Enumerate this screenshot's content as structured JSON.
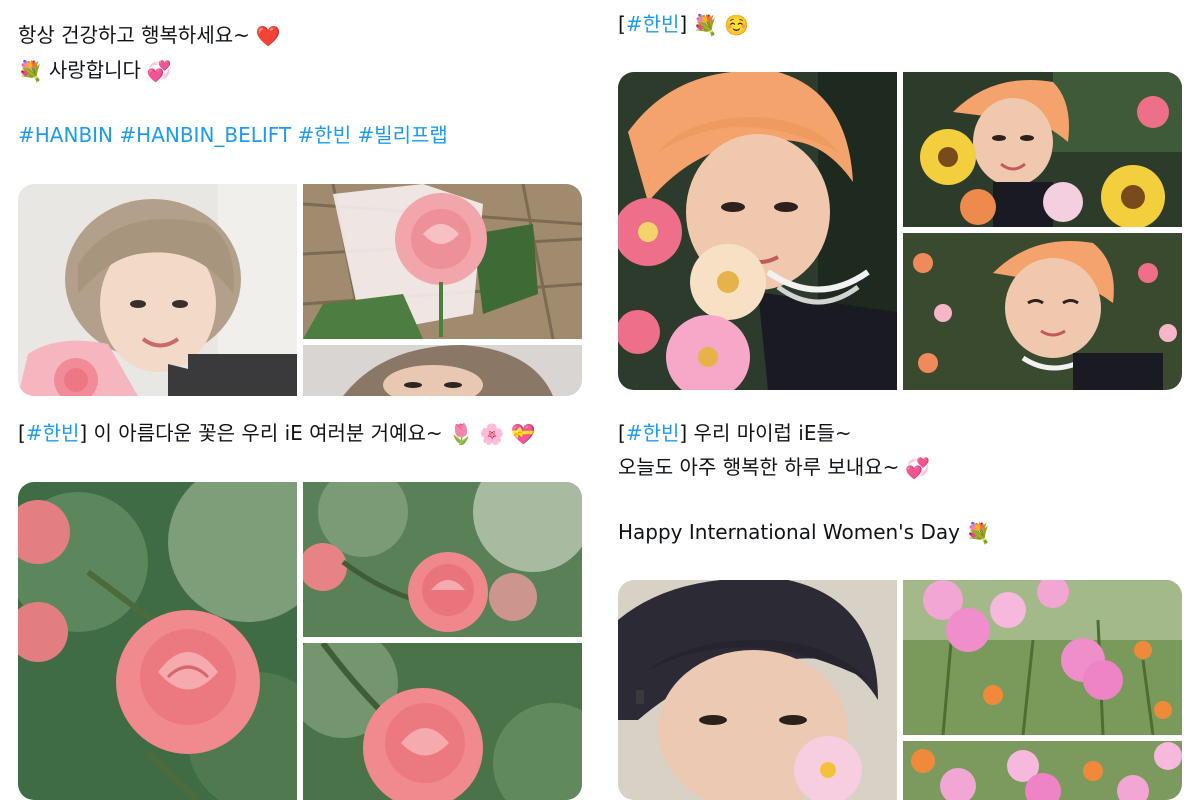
{
  "left_post_1": {
    "line1": "항상 건강하고 행복하세요~",
    "line1_emoji": "❤️",
    "line2_emoji": "💐",
    "line2": "사랑합니다",
    "line2_emoji_end": "💞",
    "hashtags": [
      "#HANBIN",
      "#HANBIN_BELIFT",
      "#한빈",
      "#빌리프랩"
    ],
    "photos": [
      {
        "name": "hanbin-bouquet-photo",
        "desc": "portrait-with-pink-roses"
      },
      {
        "name": "pink-rose-bouquet-photo",
        "desc": "pink-rose"
      },
      {
        "name": "hanbin-closeup-photo",
        "desc": "closeup"
      }
    ]
  },
  "left_post_2": {
    "bracket_open": "[",
    "tag": "#한빈",
    "bracket_close": "]",
    "text": "이 아름다운 꽃은 우리 iE 여러분 거예요~",
    "emojis": [
      "🌷",
      "🌸",
      "💝"
    ],
    "photos": [
      {
        "name": "rose-photo-large",
        "desc": "pink-rose"
      },
      {
        "name": "rose-photo-top-right",
        "desc": "pink-rose"
      },
      {
        "name": "rose-photo-bottom-right",
        "desc": "pink-rose"
      }
    ]
  },
  "right_post_1": {
    "bracket_open": "[",
    "tag": "#한빈",
    "bracket_close": "]",
    "emojis": [
      "💐",
      "☺️"
    ],
    "photos": [
      {
        "name": "hanbin-flowers-photo-large"
      },
      {
        "name": "hanbin-sunflowers-photo"
      },
      {
        "name": "hanbin-smiling-flowers-photo"
      }
    ]
  },
  "right_post_2": {
    "bracket_open": "[",
    "tag": "#한빈",
    "bracket_close": "]",
    "line1": "우리 마이럽 iE들~",
    "line2": "오늘도 아주 행복한 하루 보내요~",
    "line2_emoji": "💞",
    "line3": "Happy International Women's Day",
    "line3_emoji": "💐",
    "photos": [
      {
        "name": "hanbin-dark-hair-photo"
      },
      {
        "name": "cosmos-flowers-photo-top"
      },
      {
        "name": "cosmos-flowers-photo-bottom"
      }
    ]
  },
  "colors": {
    "link": "#1d9bf0",
    "text": "#0f1419",
    "rose": "#f08a8f",
    "peach_hair": "#f3a36b",
    "cosmos": "#f2a6d4"
  }
}
